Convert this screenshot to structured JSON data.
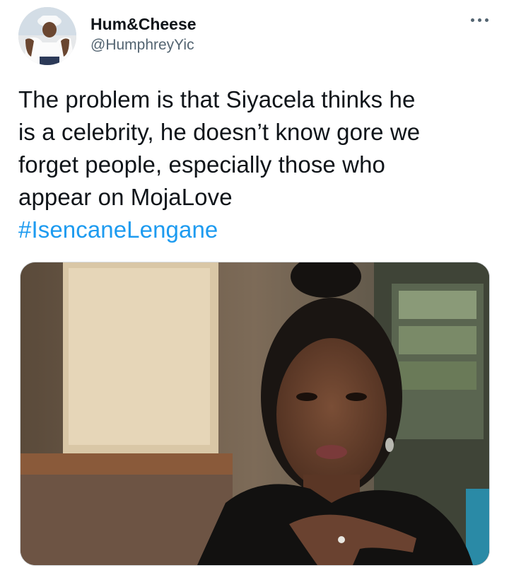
{
  "user": {
    "display_name": "Hum&Cheese",
    "handle": "@HumphreyYic",
    "avatar_icon": "profile-photo"
  },
  "menu": {
    "icon": "more-horizontal-icon"
  },
  "tweet": {
    "text": "The problem is that Siyacela thinks he\nis a celebrity, he doesn’t know gore we\nforget people, especially those who\nappear on MojaLove",
    "hashtag": "#IsencaneLengane"
  },
  "colors": {
    "text": "#0f1419",
    "secondary": "#536471",
    "link": "#1d9bf0"
  }
}
